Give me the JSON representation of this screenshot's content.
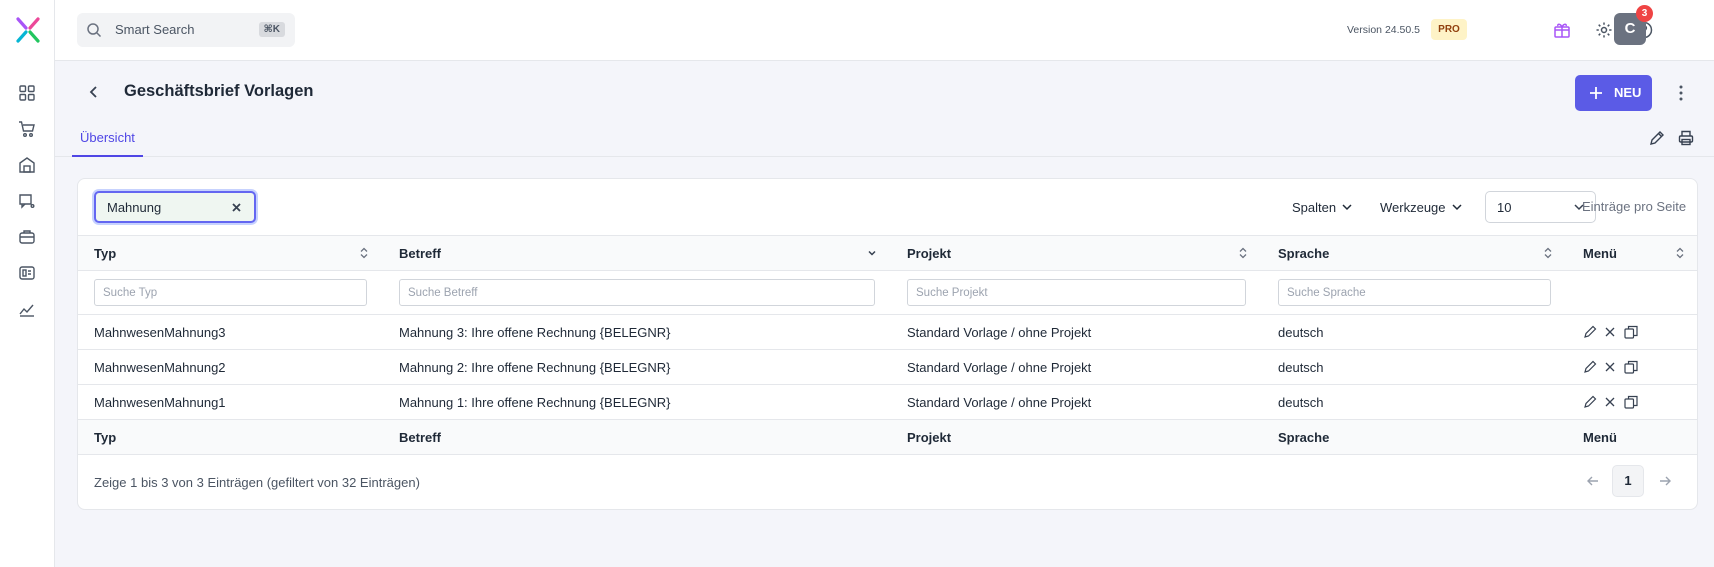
{
  "search": {
    "placeholder": "Smart Search",
    "shortcut": "⌘K"
  },
  "header": {
    "version": "Version 24.50.5",
    "plan_badge": "PRO",
    "avatar_initial": "C",
    "notification_count": "3"
  },
  "page": {
    "title": "Geschäftsbrief Vorlagen",
    "new_button_label": "NEU"
  },
  "tabs": [
    {
      "label": "Übersicht",
      "active": true
    }
  ],
  "sidebar": {
    "icons": [
      "dashboard-icon",
      "cart-icon",
      "warehouse-icon",
      "delivery-icon",
      "production-icon",
      "accounting-icon",
      "analytics-icon"
    ]
  },
  "table": {
    "filter_value": "Mahnung",
    "toolbar": {
      "columns": "Spalten",
      "tools": "Werkzeuge",
      "page_size": "10",
      "per_page_label": "Einträge pro Seite"
    },
    "columns": [
      "Typ",
      "Betreff",
      "Projekt",
      "Sprache",
      "Menü"
    ],
    "filter_placeholders": [
      "Suche Typ",
      "Suche Betreff",
      "Suche Projekt",
      "Suche Sprache"
    ],
    "rows": [
      {
        "typ": "MahnwesenMahnung3",
        "betreff": "Mahnung 3: Ihre offene Rechnung {BELEGNR}",
        "projekt": "Standard Vorlage / ohne Projekt",
        "sprache": "deutsch"
      },
      {
        "typ": "MahnwesenMahnung2",
        "betreff": "Mahnung 2: Ihre offene Rechnung {BELEGNR}",
        "projekt": "Standard Vorlage / ohne Projekt",
        "sprache": "deutsch"
      },
      {
        "typ": "MahnwesenMahnung1",
        "betreff": "Mahnung 1: Ihre offene Rechnung {BELEGNR}",
        "projekt": "Standard Vorlage / ohne Projekt",
        "sprache": "deutsch"
      }
    ],
    "info": "Zeige 1 bis 3 von 3 Einträgen (gefiltert von 32 Einträgen)",
    "current_page": "1"
  },
  "colors": {
    "accent": "#5b5be6",
    "badge_bg": "#fef3c7",
    "notification": "#ef4444"
  }
}
